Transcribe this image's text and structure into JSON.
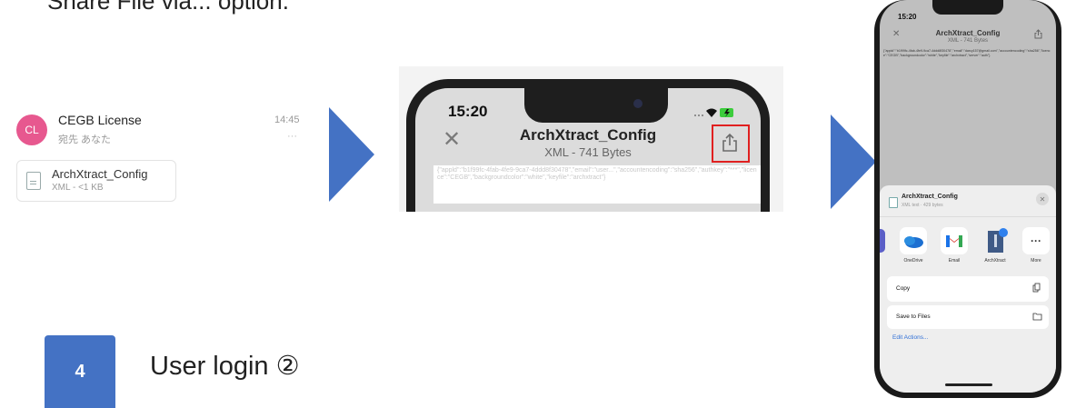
{
  "instruction": {
    "text": "Share File via... option."
  },
  "mail": {
    "avatar": "CL",
    "sender": "CEGB License",
    "recipient": "宛先 あなた",
    "time": "14:45",
    "more": "···",
    "attachment": {
      "name": "ArchXtract_Config",
      "meta": "XML - <1 KB"
    }
  },
  "middle_phone": {
    "time": "15:20",
    "title": "ArchXtract_Config",
    "subtitle": "XML - 741 Bytes",
    "close": "✕",
    "content": "{\"appld\":\"b1f99fc-4fab-4fe9-9ca7-4ddd8f30478\",\"email\":\"user...\",\"accountencoding\":\"sha256\",\"authkey\":\"***\",\"licence\":\"CEGB\",\"backgroundcolor\":\"white\",\"keyfile\":\"archxtract\"}"
  },
  "right_phone": {
    "time": "15:20",
    "title": "ArchXtract_Config",
    "subtitle": "XML - 741 Bytes",
    "close": "✕",
    "content": "{\"appld\":\"b1f99fc-4fab-4fe9-9ca7-4ddd8f30478\",\"email\":\"darcy157@gmail.com\",\"accountencoding\":\"sha256\",\"licence\":\"CEGB\",\"backgroundcolor\":\"white\",\"keyfile\":\"archxtract\",\"server\":\"auth\"}",
    "sheet": {
      "file_name": "ArchXtract_Config",
      "file_meta": "XML text · 429 bytes",
      "close": "✕",
      "apps": [
        {
          "label": "OneDrive"
        },
        {
          "label": "Email"
        },
        {
          "label": "ArchXtract"
        },
        {
          "label": "More"
        }
      ],
      "actions": [
        {
          "label": "Copy"
        },
        {
          "label": "Save to Files"
        }
      ],
      "edit_actions": "Edit Actions..."
    }
  },
  "step": {
    "number": "4",
    "title": "User login ②"
  },
  "colors": {
    "accent": "#4472c4",
    "highlight": "#e02020",
    "avatar": "#e7588f"
  }
}
